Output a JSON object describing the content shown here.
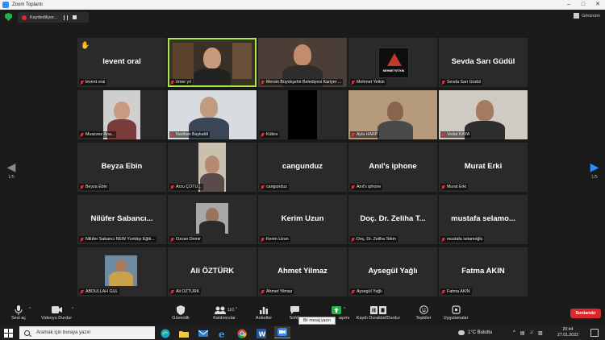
{
  "window": {
    "title": "Zoom Toplantı"
  },
  "recording": {
    "label": "Kaydediliyor..."
  },
  "view": {
    "label": "Görünüm"
  },
  "paging": {
    "left": "1/5",
    "right": "1/5"
  },
  "participants": [
    {
      "center": "levent oral",
      "label": "levent oral",
      "hand": true
    },
    {
      "center": "",
      "label": "ömer yıl",
      "active": true
    },
    {
      "center": "",
      "label": "Mersin Büyükşehir Belediyesi Kariyer ..."
    },
    {
      "center": "",
      "label": "Mehmet Yetkin",
      "logo": "MEHMETYETKİN"
    },
    {
      "center": "Sevda Sarı Güdül",
      "label": "Sevda Sarı Güdül"
    },
    {
      "center": "",
      "label": "Muazzez Ana..."
    },
    {
      "center": "",
      "label": "Nartkan Baykaldi"
    },
    {
      "center": "",
      "label": "Kübra"
    },
    {
      "center": "",
      "label": "Ayla HARP"
    },
    {
      "center": "",
      "label": "Vedat KAYA"
    },
    {
      "center": "Beyza Ebin",
      "label": "Beyza Ebin"
    },
    {
      "center": "",
      "label": "Arzu ÇOTU..."
    },
    {
      "center": "cangunduz",
      "label": "cangunduz"
    },
    {
      "center": "Anıl's iphone",
      "label": "Anıl's iphone"
    },
    {
      "center": "Murat Erki",
      "label": "Murat Erki"
    },
    {
      "center": "Nilüfer Sabancı...",
      "label": "Nilüfer Sabancı NEW Yurtdışı Eğiti..."
    },
    {
      "center": "",
      "label": "Ozcan Demir"
    },
    {
      "center": "Kerim Uzun",
      "label": "Kerim Uzun"
    },
    {
      "center": "Doç. Dr. Zeliha T...",
      "label": "Doç. Dr. Zeliha Tekin"
    },
    {
      "center": "mustafa selamo...",
      "label": "mustafa selamoğlu"
    },
    {
      "center": "",
      "label": "ABDULLAH GÜL"
    },
    {
      "center": "Ali ÖZTÜRK",
      "label": "Ali ÖZTÜRK"
    },
    {
      "center": "Ahmet Yilmaz",
      "label": "Ahmet Yilmaz"
    },
    {
      "center": "Aysegül Yağlı",
      "label": "Aysegül Yağlı"
    },
    {
      "center": "Fatma AKIN",
      "label": "Fatma AKIN"
    }
  ],
  "toolbar": {
    "mute": "Sesi aç",
    "video": "Videoyu Durdur",
    "security": "Güvenlik",
    "participants": "Katılımcılar",
    "participants_count": "110",
    "polls": "Anketler",
    "chat": "Sohb",
    "share_suffix": "aşımı",
    "record": "Kaydı Duraklat/Durdur",
    "reactions": "Tepkiler",
    "apps": "Uygulamalar",
    "end": "Sonlandır"
  },
  "tooltip": {
    "text": "Bir mesaj yazın"
  },
  "taskbar": {
    "search_placeholder": "Aramak için buraya yazın",
    "weather": "1°C  Bulutlu",
    "time": "20:44",
    "date": "27.01.2022"
  }
}
